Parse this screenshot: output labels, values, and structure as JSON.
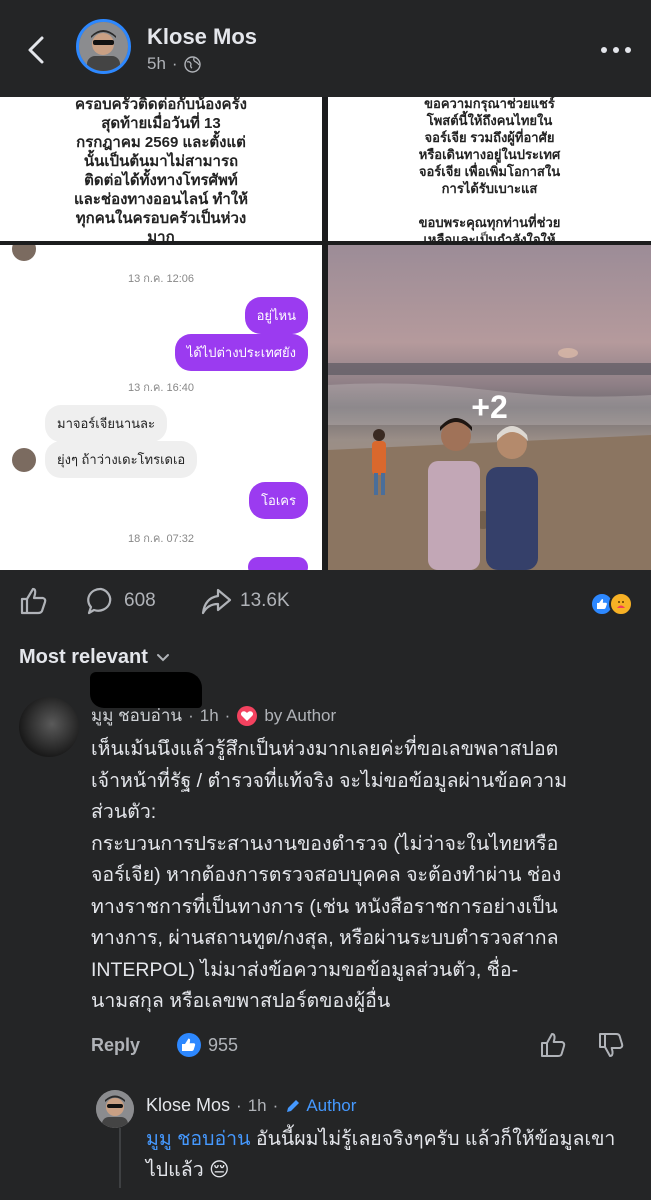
{
  "post": {
    "author": "Klose Mos",
    "time": "5h",
    "dot": "·"
  },
  "images": {
    "top_left_text": "ครอบครัวติดต่อกับน้องครั้ง\nสุดท้ายเมื่อวันที่ 13\nกรกฎาคม 2569 และตั้งแต่\nนั้นเป็นต้นมาไม่สามารถ\nติดต่อได้ทั้งทางโทรศัพท์\nและช่องทางออนไลน์ ทำให้\nทุกคนในครอบครัวเป็นห่วง\nมาก",
    "top_right_text": "ขอความกรุณาช่วยแชร์\nโพสต์นี้ให้ถึงคนไทยใน\nจอร์เจีย รวมถึงผู้ที่อาศัย\nหรือเดินทางอยู่ในประเทศ\nจอร์เจีย เพื่อเพิ่มโอกาสใน\nการได้รับเบาะแส\n\nขอบพระคุณทุกท่านที่ช่วย\nเหลือและเป็นกำลังใจให้\nครอบครัวของเราครับ 🙏",
    "more_count": "+2",
    "chat": {
      "ts1": "13 ก.ค. 12:06",
      "out1": "อยู่ไหน",
      "out2": "ได้ไปต่างประเทศยัง",
      "ts2": "13 ก.ค. 16:40",
      "in1": "มาจอร์เจียนานละ",
      "in2": "ยุ่งๆ ถ้าว่างเดะโทรเดเอ",
      "out3": "โอเคร",
      "ts3": "18 ก.ค. 07:32"
    }
  },
  "actions": {
    "comments_count": "608",
    "shares_count": "13.6K"
  },
  "sort_label": "Most relevant",
  "comment": {
    "name": "มูมู ชอบอ่าน",
    "time": "1h",
    "dot": "·",
    "author_badge": "by Author",
    "body": "เห็นเม้นนึงแล้วรู้สึกเป็นห่วงมากเลยค่ะที่ขอเลขพลาสปอต\nเจ้าหน้าที่รัฐ / ตำรวจที่แท้จริง จะไม่ขอข้อมูลผ่านข้อความ\nส่วนตัว:\nกระบวนการประสานงานของตำรวจ (ไม่ว่าจะในไทยหรือ\nจอร์เจีย) หากต้องการตรวจสอบบุคคล จะต้องทำผ่าน ช่อง\nทางราชการที่เป็นทางการ (เช่น หนังสือราชการอย่างเป็น\nทางการ, ผ่านสถานทูต/กงสุล, หรือผ่านระบบตำรวจสากล\nINTERPOL) ไม่มาส่งข้อความขอข้อมูลส่วนตัว, ชื่อ-\nนามสกุล หรือเลขพาสปอร์ตของผู้อื่น",
    "reply_label": "Reply",
    "likes": "955"
  },
  "reply": {
    "name": "Klose Mos",
    "time": "1h",
    "dot": "·",
    "author_label": "Author",
    "mention": "มูมู ชอบอ่าน",
    "text": " อันนี้ผมไม่รู้เลยจริงๆครับ แล้วก็ให้ข้อมูลเขาไปแล้ว 😔"
  },
  "colors": {
    "background": "#242526",
    "accent": "#2d88ff",
    "link": "#4599ff",
    "chat_bubble": "#9b3bf0"
  }
}
